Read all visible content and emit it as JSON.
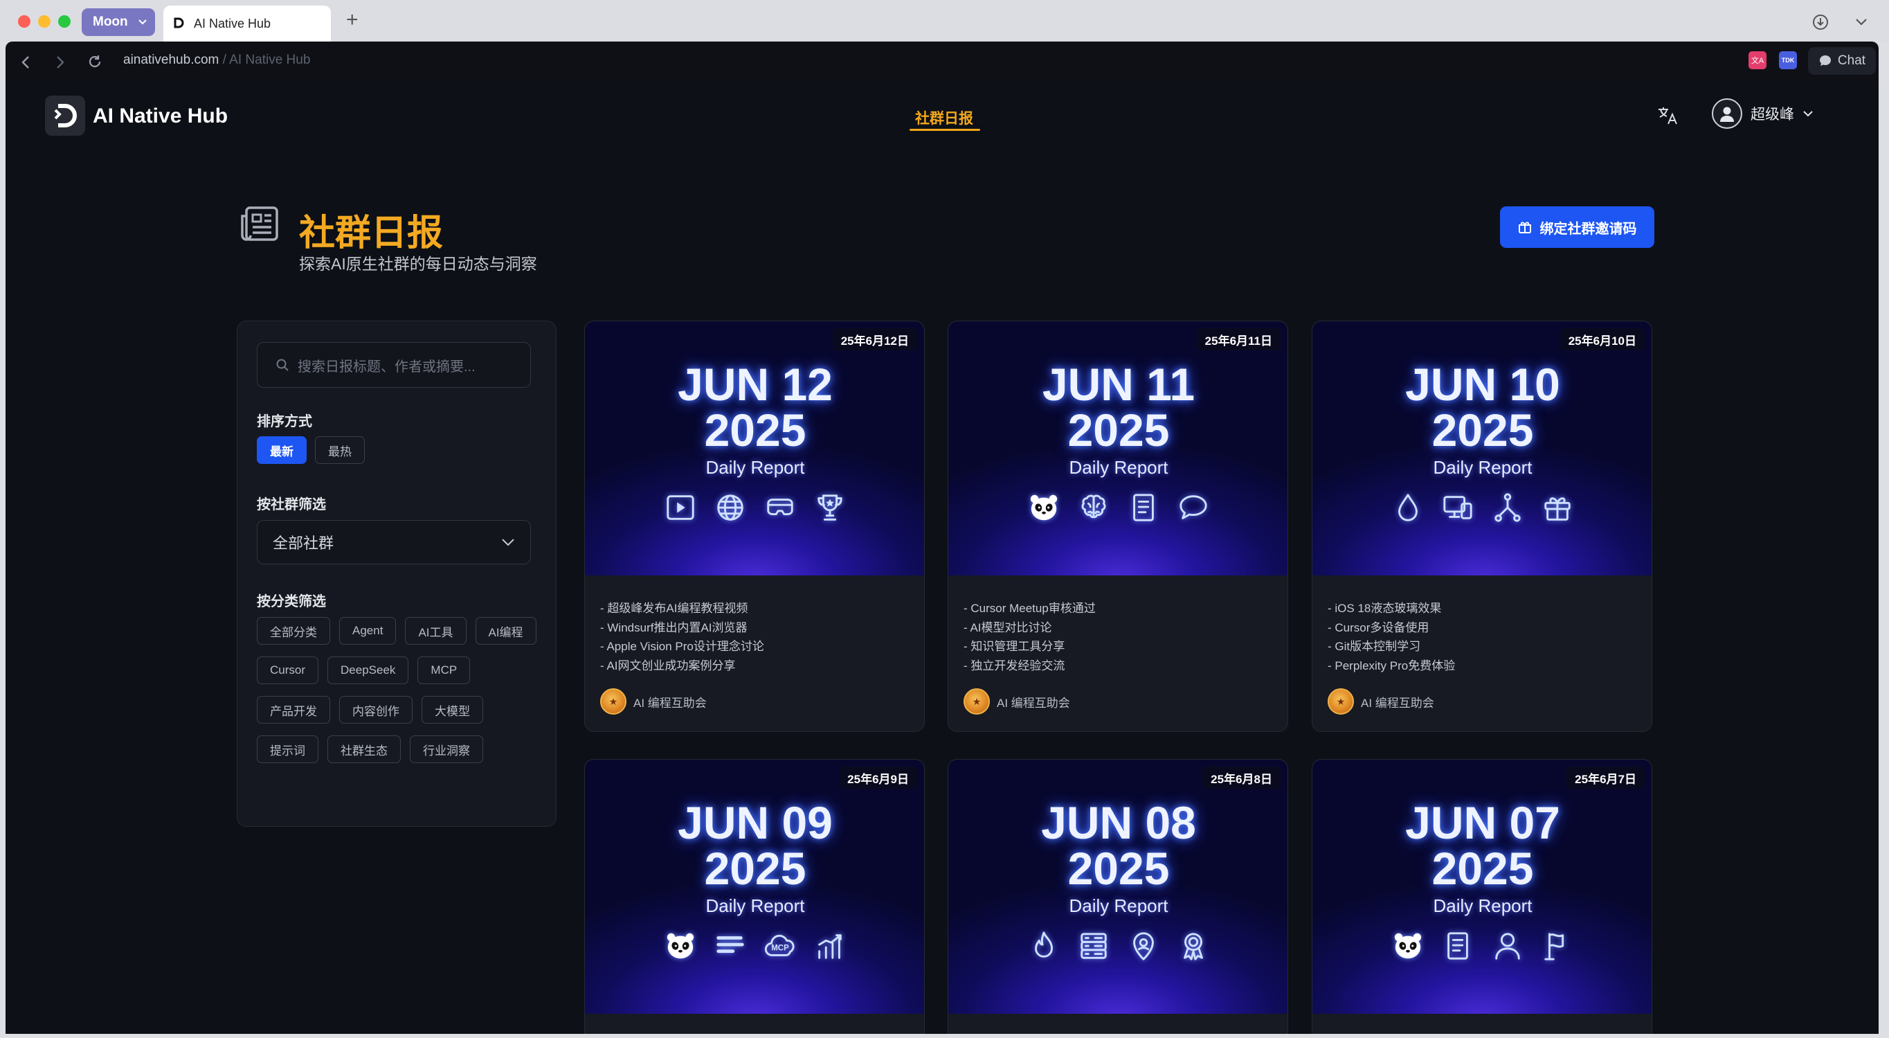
{
  "browser": {
    "profile_label": "Moon",
    "tab_title": "AI Native Hub",
    "new_tab": "+",
    "url_host": "ainativehub.com",
    "url_sep": " / ",
    "url_path": "AI Native Hub",
    "chat_label": "Chat",
    "ext1": "文A",
    "ext2": "TDK"
  },
  "header": {
    "brand": "AI Native Hub",
    "nav_active": "社群日报",
    "user_name": "超级峰"
  },
  "page": {
    "title": "社群日报",
    "subtitle": "探索AI原生社群的每日动态与洞察",
    "bind_button": "绑定社群邀请码"
  },
  "sidebar": {
    "search_placeholder": "搜索日报标题、作者或摘要...",
    "sort_label": "排序方式",
    "sort_options": [
      "最新",
      "最热"
    ],
    "sort_active": "最新",
    "community_label": "按社群筛选",
    "community_value": "全部社群",
    "category_label": "按分类筛选",
    "categories": [
      "全部分类",
      "Agent",
      "AI工具",
      "AI编程",
      "Cursor",
      "DeepSeek",
      "MCP",
      "产品开发",
      "内容创作",
      "大模型",
      "提示词",
      "社群生态",
      "行业洞察"
    ]
  },
  "cards": [
    {
      "badge": "25年6月12日",
      "day": "JUN 12",
      "year": "2025",
      "label": "Daily Report",
      "icons": [
        "play-icon",
        "globe-icon",
        "vr-headset-icon",
        "trophy-icon"
      ],
      "summary": [
        "- 超级峰发布AI编程教程视频",
        "- Windsurf推出内置AI浏览器",
        "- Apple Vision Pro设计理念讨论",
        "- AI网文创业成功案例分享"
      ],
      "author": "AI 编程互助会"
    },
    {
      "badge": "25年6月11日",
      "day": "JUN 11",
      "year": "2025",
      "label": "Daily Report",
      "icons": [
        "panda-icon",
        "brain-icon",
        "document-icon",
        "chat-bubble-icon"
      ],
      "summary": [
        "- Cursor Meetup审核通过",
        "- AI模型对比讨论",
        "- 知识管理工具分享",
        "- 独立开发经验交流"
      ],
      "author": "AI 编程互助会"
    },
    {
      "badge": "25年6月10日",
      "day": "JUN 10",
      "year": "2025",
      "label": "Daily Report",
      "icons": [
        "drop-icon",
        "devices-icon",
        "git-branch-icon",
        "gift-icon"
      ],
      "summary": [
        "- iOS 18液态玻璃效果",
        "- Cursor多设备使用",
        "- Git版本控制学习",
        "- Perplexity Pro免费体验"
      ],
      "author": "AI 编程互助会"
    },
    {
      "badge": "25年6月9日",
      "day": "JUN 09",
      "year": "2025",
      "label": "Daily Report",
      "icons": [
        "panda-icon",
        "text-lines-icon",
        "mcp-cloud-icon",
        "chart-up-icon"
      ],
      "mcp_text": "MCP",
      "summary": [],
      "author": ""
    },
    {
      "badge": "25年6月8日",
      "day": "JUN 08",
      "year": "2025",
      "label": "Daily Report",
      "icons": [
        "flame-icon",
        "server-icon",
        "location-icon",
        "award-icon"
      ],
      "summary": [],
      "author": ""
    },
    {
      "badge": "25年6月7日",
      "day": "JUN 07",
      "year": "2025",
      "label": "Daily Report",
      "icons": [
        "panda-icon",
        "document-icon",
        "person-icon",
        "flag-icon"
      ],
      "summary": [],
      "author": ""
    }
  ]
}
